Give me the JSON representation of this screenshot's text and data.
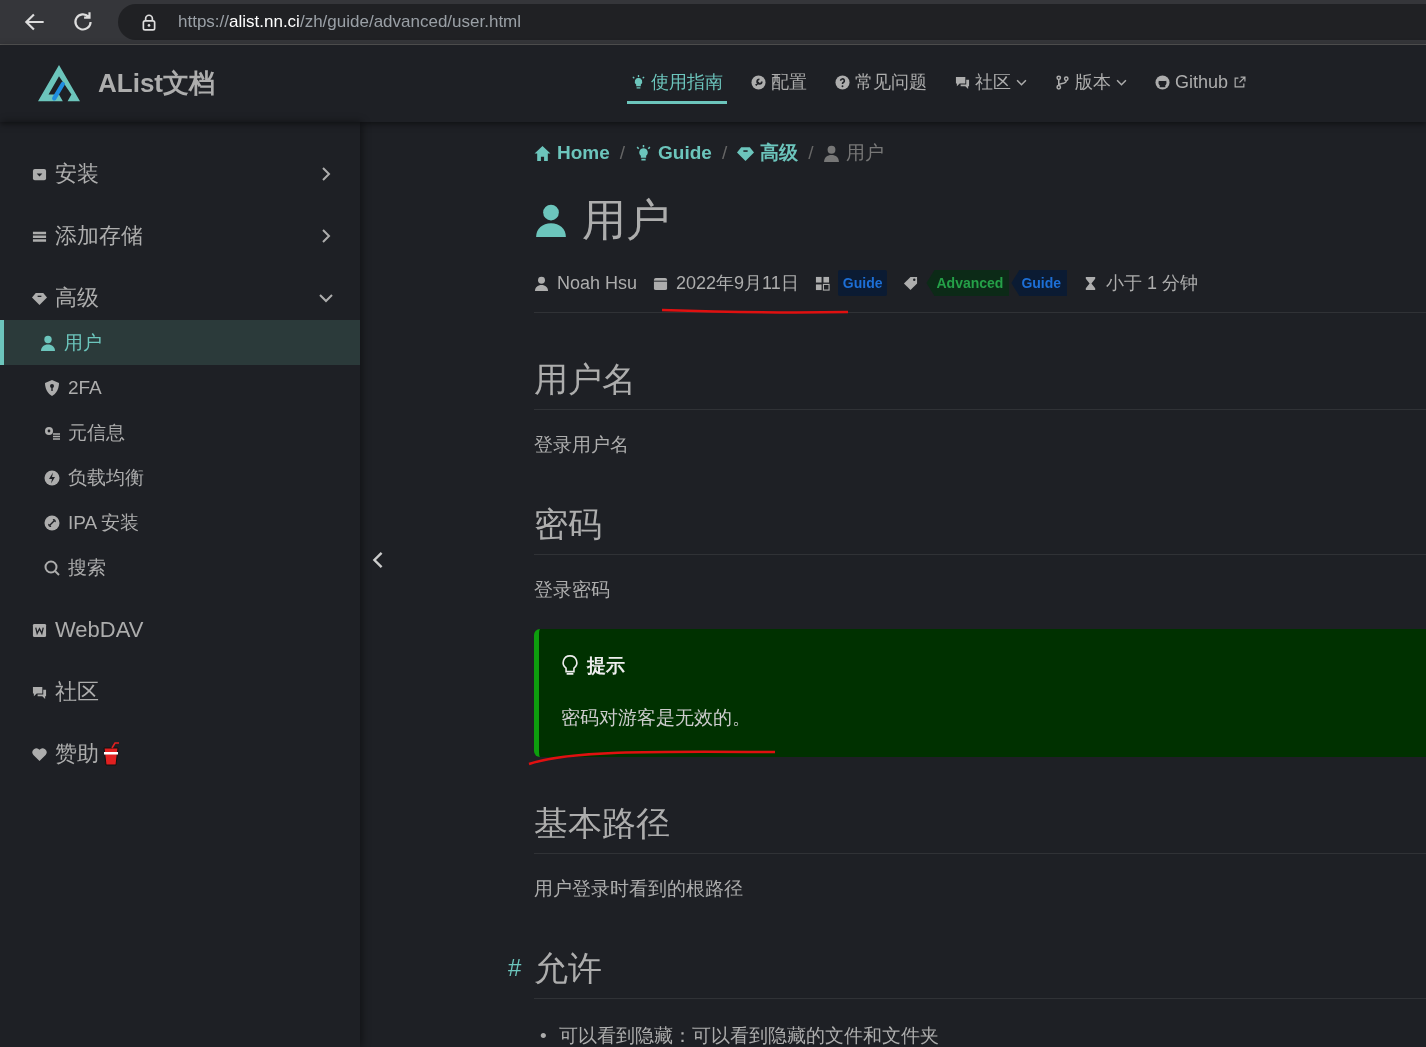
{
  "browser": {
    "scheme": "https://",
    "host": "alist.nn.ci",
    "path": "/zh/guide/advanced/user.html"
  },
  "header": {
    "logo_text": "AList文档",
    "nav": [
      {
        "label": "使用指南",
        "selected": true,
        "dropdown": false,
        "external": false
      },
      {
        "label": "配置",
        "selected": false,
        "dropdown": false,
        "external": false
      },
      {
        "label": "常见问题",
        "selected": false,
        "dropdown": false,
        "external": false
      },
      {
        "label": "社区",
        "selected": false,
        "dropdown": true,
        "external": false
      },
      {
        "label": "版本",
        "selected": false,
        "dropdown": true,
        "external": false
      },
      {
        "label": "Github",
        "selected": false,
        "dropdown": false,
        "external": true
      }
    ]
  },
  "sidebar": {
    "items": [
      {
        "label": "安装",
        "expanded": false
      },
      {
        "label": "添加存储",
        "expanded": false
      },
      {
        "label": "高级",
        "expanded": true,
        "children": [
          {
            "label": "用户",
            "selected": true
          },
          {
            "label": "2FA",
            "selected": false
          },
          {
            "label": "元信息",
            "selected": false
          },
          {
            "label": "负载均衡",
            "selected": false
          },
          {
            "label": "IPA 安装",
            "selected": false
          },
          {
            "label": "搜索",
            "selected": false
          }
        ]
      },
      {
        "label": "WebDAV"
      },
      {
        "label": "社区"
      },
      {
        "label": "赞助"
      }
    ]
  },
  "breadcrumb": [
    {
      "label": "Home",
      "current": false
    },
    {
      "separator": "/",
      "label": "Guide",
      "current": false
    },
    {
      "separator": "/",
      "label": "高级",
      "current": false
    },
    {
      "separator": "/",
      "label": "用户",
      "current": true
    }
  ],
  "title": "用户",
  "meta": {
    "author": "Noah Hsu",
    "date": "2022年9月11日",
    "category": "Guide",
    "tags": [
      "Advanced",
      "Guide"
    ],
    "reading_time": "小于 1 分钟"
  },
  "sections": [
    {
      "kind": "text",
      "heading": "用户名",
      "text": "登录用户名"
    },
    {
      "kind": "text",
      "heading": "密码",
      "text": "登录密码",
      "tip": {
        "title": "提示",
        "text": "密码对游客是无效的。"
      }
    },
    {
      "kind": "text",
      "heading": "基本路径",
      "text": "用户登录时看到的根路径"
    },
    {
      "kind": "list",
      "heading": "允许",
      "anchor": "#",
      "items": [
        {
          "marker": "•",
          "text": "可以看到隐藏：可以看到隐藏的文件和文件夹"
        }
      ]
    }
  ]
}
